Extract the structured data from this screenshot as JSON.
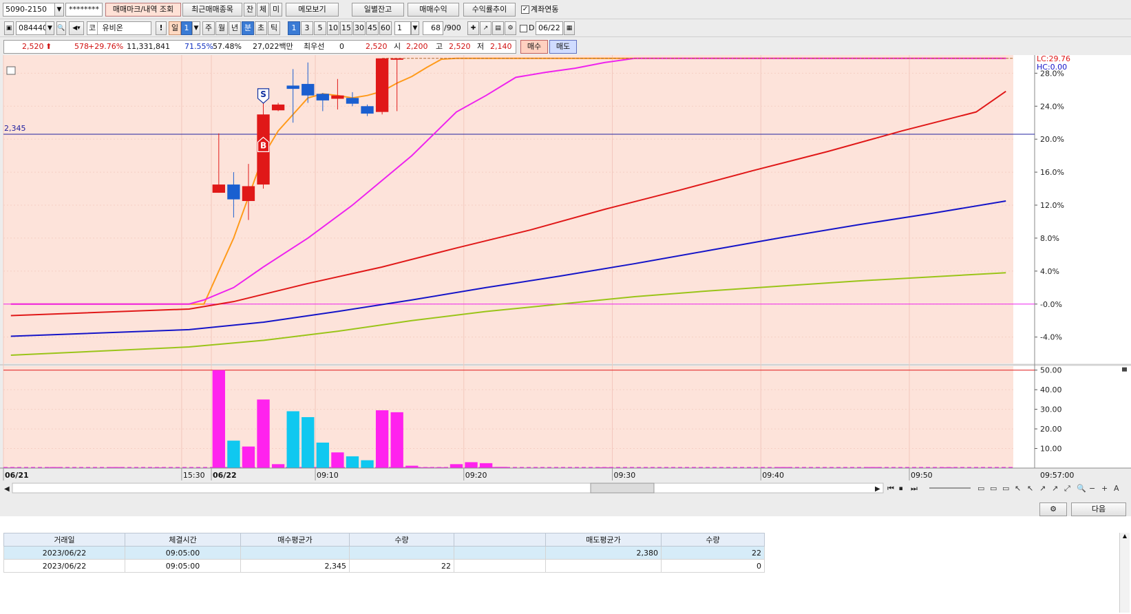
{
  "toolbar1": {
    "account": "5090-2150",
    "password": "********",
    "tab_marks": "매매마크/내역 조회",
    "tab_recent": "최근매매종목",
    "btn_jan": "잔",
    "btn_che": "체",
    "btn_mi": "미",
    "btn_memo": "메모보기",
    "btn_daily": "일별잔고",
    "btn_profit": "매매수익",
    "btn_rate": "수익률추이",
    "chk_link_label": "계좌연동"
  },
  "toolbar2": {
    "code": "084440",
    "market": "코",
    "name": "유비온",
    "excl": "!",
    "periods": [
      "일",
      "1",
      "주",
      "월",
      "년",
      "분",
      "초",
      "틱"
    ],
    "minutes": [
      "1",
      "3",
      "5",
      "10",
      "15",
      "30",
      "45",
      "60"
    ],
    "interval": "1",
    "count": "68",
    "count_total": "/900",
    "d_label": "D",
    "date": "06/22"
  },
  "quote": {
    "price": "2,520",
    "change": "578",
    "change_pct": "+29.76%",
    "volume": "11,331,841",
    "pct1": "71.55%",
    "pct2": "57.48%",
    "amount": "27,022백만",
    "best_label": "최우선",
    "best_qty": "0",
    "best_price": "2,520",
    "open_label": "시",
    "open": "2,200",
    "high_label": "고",
    "high": "2,520",
    "low_label": "저",
    "low": "2,140",
    "buy_btn": "매수",
    "sell_btn": "매도"
  },
  "chart_data": {
    "type": "candlestick",
    "price_level_label": "2,345",
    "lc_label": "LC:29.76",
    "hc_label": "HC:0.00",
    "y_ticks": [
      "28.0%",
      "24.0%",
      "20.0%",
      "16.0%",
      "12.0%",
      "8.0%",
      "4.0%",
      "-0.0%",
      "-4.0%"
    ],
    "y_values": [
      28,
      24,
      20,
      16,
      12,
      8,
      4,
      0,
      -4
    ],
    "ylim": [
      -7.2,
      30.2
    ],
    "ref_level_pct": 20.6,
    "candles": [
      {
        "x": 14,
        "open": 13.5,
        "close": 14.5,
        "high": 20.7,
        "low": 13.5
      },
      {
        "x": 15,
        "open": 14.5,
        "close": 12.7,
        "high": 16.0,
        "low": 10.5
      },
      {
        "x": 16,
        "open": 12.5,
        "close": 14.3,
        "high": 17.0,
        "low": 10.2
      },
      {
        "x": 17,
        "open": 14.5,
        "close": 23.0,
        "high": 24.5,
        "low": 14.0
      },
      {
        "x": 18,
        "open": 23.5,
        "close": 24.2,
        "high": 24.4,
        "low": 23.4
      },
      {
        "x": 19,
        "open": 26.5,
        "close": 26.1,
        "high": 28.5,
        "low": 22.0
      },
      {
        "x": 20,
        "open": 26.7,
        "close": 25.3,
        "high": 29.3,
        "low": 24.4
      },
      {
        "x": 21,
        "open": 25.5,
        "close": 24.7,
        "high": 25.6,
        "low": 23.4
      },
      {
        "x": 22,
        "open": 24.9,
        "close": 25.3,
        "high": 27.3,
        "low": 23.6
      },
      {
        "x": 23,
        "open": 25.0,
        "close": 24.3,
        "high": 25.7,
        "low": 24.0
      },
      {
        "x": 24,
        "open": 24.0,
        "close": 23.1,
        "high": 24.2,
        "low": 22.8
      },
      {
        "x": 25,
        "open": 23.3,
        "close": 29.8,
        "high": 29.8,
        "low": 23.0
      },
      {
        "x": 26,
        "open": 29.8,
        "close": 29.8,
        "high": 29.8,
        "low": 23.4
      }
    ],
    "ma_lines": [
      {
        "color": "#ff9a1a",
        "x": [
          0,
          12,
          13,
          15,
          16,
          17,
          18,
          19,
          20,
          21,
          22,
          23,
          24,
          25,
          26,
          27,
          28,
          29,
          30,
          31,
          32,
          33,
          34,
          35,
          36,
          37,
          38,
          39,
          40,
          41,
          42,
          43,
          44,
          45,
          46,
          47,
          48,
          49,
          50,
          51,
          52,
          53,
          54,
          55,
          56,
          57,
          58,
          59,
          60,
          61,
          62,
          63,
          64,
          65,
          66,
          67
        ],
        "y": [
          0,
          0,
          0,
          8,
          13,
          18,
          21,
          23,
          25,
          25.5,
          25.3,
          25,
          25.3,
          25.8,
          26.8,
          27.6,
          28.7,
          29.7,
          29.8,
          29.8,
          29.8,
          29.8,
          29.8,
          29.8,
          29.8,
          29.8,
          29.8,
          29.8,
          29.8,
          29.8,
          29.8,
          29.8,
          29.8,
          29.8,
          29.8,
          29.8,
          29.8,
          29.8,
          29.8,
          29.8,
          29.8,
          29.8,
          29.8,
          29.8,
          29.8,
          29.8,
          29.8,
          29.8,
          29.8,
          29.8,
          29.8,
          29.8,
          29.8,
          29.8,
          29.8,
          29.8
        ]
      },
      {
        "color": "#ee22ee",
        "x": [
          0,
          12,
          13,
          15,
          17,
          20,
          23,
          27,
          30,
          32,
          34,
          36,
          38,
          40,
          42,
          43,
          67
        ],
        "y": [
          0,
          0,
          0.5,
          2,
          4.5,
          8,
          12,
          18,
          23.3,
          25.3,
          27.5,
          28.1,
          28.6,
          29.3,
          29.8,
          29.8,
          29.8
        ]
      },
      {
        "color": "#e01818",
        "x": [
          0,
          12,
          15,
          20,
          25,
          30,
          35,
          40,
          45,
          50,
          55,
          60,
          65,
          67
        ],
        "y": [
          -1.4,
          -0.6,
          0.3,
          2.5,
          4.5,
          6.8,
          9,
          11.5,
          13.8,
          16.2,
          18.5,
          21,
          23.3,
          25.8
        ]
      },
      {
        "color": "#1414c8",
        "x": [
          0,
          12,
          17,
          22,
          27,
          32,
          37,
          42,
          47,
          52,
          57,
          62,
          67
        ],
        "y": [
          -3.9,
          -3.1,
          -2.2,
          -0.9,
          0.5,
          2,
          3.4,
          4.9,
          6.5,
          8.1,
          9.6,
          11,
          12.5
        ]
      },
      {
        "color": "#9ac418",
        "x": [
          0,
          12,
          17,
          22,
          27,
          32,
          37,
          42,
          47,
          52,
          57,
          62,
          67
        ],
        "y": [
          -6.2,
          -5.2,
          -4.4,
          -3.3,
          -2,
          -0.9,
          0,
          0.9,
          1.6,
          2.2,
          2.8,
          3.3,
          3.8
        ]
      }
    ],
    "volume": {
      "y_ticks": [
        "50.00",
        "40.00",
        "30.00",
        "20.00",
        "10.00"
      ],
      "y_values": [
        50,
        40,
        30,
        20,
        10
      ],
      "ylim": [
        0,
        52
      ],
      "bars": [
        {
          "x": 0,
          "v": 0.3,
          "c": "m"
        },
        {
          "x": 3,
          "v": 0.5,
          "c": "m"
        },
        {
          "x": 7,
          "v": 0.5,
          "c": "m"
        },
        {
          "x": 10,
          "v": 0.3,
          "c": "m"
        },
        {
          "x": 14,
          "v": 50,
          "c": "m"
        },
        {
          "x": 15,
          "v": 14,
          "c": "c"
        },
        {
          "x": 16,
          "v": 11,
          "c": "m"
        },
        {
          "x": 17,
          "v": 35,
          "c": "m"
        },
        {
          "x": 18,
          "v": 2,
          "c": "m"
        },
        {
          "x": 19,
          "v": 29,
          "c": "c"
        },
        {
          "x": 20,
          "v": 26,
          "c": "c"
        },
        {
          "x": 21,
          "v": 13,
          "c": "c"
        },
        {
          "x": 22,
          "v": 8,
          "c": "m"
        },
        {
          "x": 23,
          "v": 6,
          "c": "c"
        },
        {
          "x": 24,
          "v": 4,
          "c": "c"
        },
        {
          "x": 25,
          "v": 29.5,
          "c": "m"
        },
        {
          "x": 26,
          "v": 28.5,
          "c": "m"
        },
        {
          "x": 27,
          "v": 1.2,
          "c": "m"
        },
        {
          "x": 28,
          "v": 0.4,
          "c": "m"
        },
        {
          "x": 29,
          "v": 0.4,
          "c": "m"
        },
        {
          "x": 30,
          "v": 2,
          "c": "m"
        },
        {
          "x": 31,
          "v": 3,
          "c": "m"
        },
        {
          "x": 32,
          "v": 2.5,
          "c": "m"
        },
        {
          "x": 33,
          "v": 0.6,
          "c": "m"
        },
        {
          "x": 40,
          "v": 0.4,
          "c": "m"
        },
        {
          "x": 52,
          "v": 0.5,
          "c": "m"
        },
        {
          "x": 58,
          "v": 0.5,
          "c": "m"
        },
        {
          "x": 63,
          "v": 0.4,
          "c": "m"
        }
      ]
    },
    "x_labels": [
      {
        "x": 0,
        "t": "06/21",
        "bold": true
      },
      {
        "x": 12,
        "t": "15:30",
        "bold": false
      },
      {
        "x": 14,
        "t": "06/22",
        "bold": true
      },
      {
        "x": 21,
        "t": "09:10",
        "bold": false
      },
      {
        "x": 31,
        "t": "09:20",
        "bold": false
      },
      {
        "x": 41,
        "t": "09:30",
        "bold": false
      },
      {
        "x": 51,
        "t": "09:40",
        "bold": false
      },
      {
        "x": 61,
        "t": "09:50",
        "bold": false
      }
    ],
    "x_last_label": "09:57:00",
    "markers": [
      {
        "type": "S",
        "x": 17,
        "y": 25.2
      },
      {
        "type": "B",
        "x": 17,
        "y": 19.4
      }
    ]
  },
  "bottom_toolbar": {
    "next_btn": "다음"
  },
  "trades": {
    "headers": [
      "거래일",
      "체결시간",
      "매수평균가",
      "수량",
      "",
      "매도평균가",
      "수량"
    ],
    "rows": [
      [
        "2023/06/22",
        "09:05:00",
        "",
        "",
        "",
        "2,380",
        "22"
      ],
      [
        "2023/06/22",
        "09:05:00",
        "2,345",
        "22",
        "",
        "",
        "0"
      ]
    ]
  },
  "colors": {
    "up": "#e01818",
    "down": "#1a5fd0",
    "chart_bg": "#fde3da",
    "vol_magenta": "#ff22ee",
    "vol_cyan": "#10c8f0"
  }
}
